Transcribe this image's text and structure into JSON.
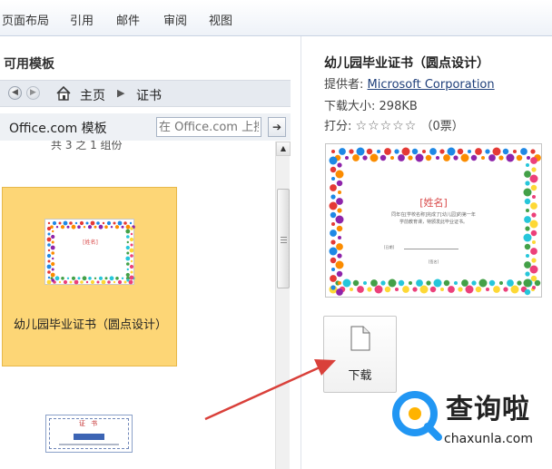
{
  "ribbon": {
    "tabs": [
      "页面布局",
      "引用",
      "邮件",
      "审阅",
      "视图"
    ]
  },
  "left_pane": {
    "title": "可用模板",
    "breadcrumb": {
      "home": "主页",
      "current": "证书"
    },
    "office_label": "Office.com 模板",
    "search_placeholder": "在 Office.com 上搜索模板",
    "count_text": "共 3 之 1 组份",
    "selected_template": "幼儿园毕业证书（圆点设计）",
    "thumbnail_name_text": "[姓名]",
    "second_template_header": "证 书"
  },
  "right_pane": {
    "title": "幼儿园毕业证书（圆点设计）",
    "provider_label": "提供者:",
    "provider_name": "Microsoft Corporation",
    "size_label": "下载大小:",
    "size_value": "298KB",
    "rating_label": "打分:",
    "rating_stars": "☆☆☆☆☆",
    "votes": "（0票）",
    "preview_name": "[姓名]",
    "preview_body_1": "同年在[学校名称]完成了[幼儿园]的第一年",
    "preview_body_2": "学前教育课，特颁发此毕业证书。",
    "preview_date": "[日期]",
    "preview_sign": "[签名]",
    "download_label": "下载"
  },
  "watermark": {
    "text": "查询啦",
    "url": "chaxunla.com"
  },
  "colors": {
    "selected_bg": "#fdd676",
    "arrow": "#d9403a",
    "link": "#1f3f7a",
    "watermark_blue": "#2196f3",
    "watermark_yellow": "#ffb300",
    "dots": [
      "#e53935",
      "#fb8c00",
      "#fdd835",
      "#43a047",
      "#1e88e5",
      "#8e24aa",
      "#ec407a",
      "#26c6da"
    ]
  },
  "icons": [
    "back-icon",
    "forward-icon",
    "home-icon",
    "chevron-right-icon",
    "search-go-icon",
    "scroll-up-icon",
    "document-icon"
  ]
}
